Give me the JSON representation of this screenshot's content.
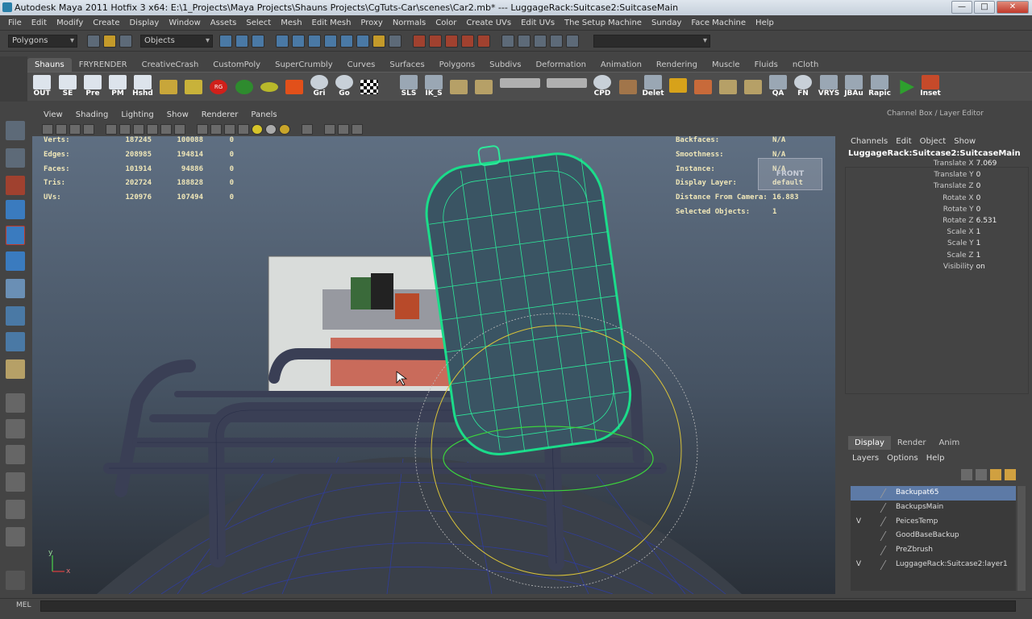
{
  "window": {
    "title": "Autodesk Maya 2011 Hotfix 3 x64: E:\\1_Projects\\Maya Projects\\Shauns Projects\\CgTuts-Car\\scenes\\Car2.mb*  ---  LuggageRack:Suitcase2:SuitcaseMain",
    "minimize": "—",
    "maximize": "□",
    "close": "✕"
  },
  "menubar": [
    "File",
    "Edit",
    "Modify",
    "Create",
    "Display",
    "Window",
    "Assets",
    "Select",
    "Mesh",
    "Edit Mesh",
    "Proxy",
    "Normals",
    "Color",
    "Create UVs",
    "Edit UVs",
    "The Setup Machine",
    "Sunday",
    "Face Machine",
    "Help"
  ],
  "statusline": {
    "mode": "Polygons",
    "selection_mask": "Objects"
  },
  "shelf_tabs": [
    "Shauns",
    "FRYRENDER",
    "CreativeCrash",
    "CustomPoly",
    "SuperCrumbly",
    "Curves",
    "Surfaces",
    "Polygons",
    "Subdivs",
    "Deformation",
    "Animation",
    "Rendering",
    "Muscle",
    "Fluids",
    "nCloth"
  ],
  "shelf_labels": {
    "out": "OUT",
    "se": "SE",
    "pre": "Pre",
    "pm": "PM",
    "hshd": "Hshd",
    "gri": "Gri",
    "go": "Go",
    "sls": "SLS",
    "ik_s": "IK_S",
    "cpd": "CPD",
    "delet": "Delet",
    "qa": "QA",
    "fn": "FN",
    "vrys": "VRYS",
    "jbau": "JBAu",
    "rapic": "Rapic",
    "inset": "Inset",
    "rg": "RG"
  },
  "viewport_menu": [
    "View",
    "Shading",
    "Lighting",
    "Show",
    "Renderer",
    "Panels"
  ],
  "hud_left": [
    {
      "label": "Verts:",
      "a": "187245",
      "b": "100088",
      "c": "0"
    },
    {
      "label": "Edges:",
      "a": "208985",
      "b": "194814",
      "c": "0"
    },
    {
      "label": "Faces:",
      "a": "101914",
      "b": "94886",
      "c": "0"
    },
    {
      "label": "Tris:",
      "a": "202724",
      "b": "188828",
      "c": "0"
    },
    {
      "label": "UVs:",
      "a": "120976",
      "b": "107494",
      "c": "0"
    }
  ],
  "hud_right": [
    {
      "label": "Backfaces:",
      "value": "N/A"
    },
    {
      "label": "Smoothness:",
      "value": "N/A"
    },
    {
      "label": "Instance:",
      "value": "N/A"
    },
    {
      "label": "Display Layer:",
      "value": "default"
    },
    {
      "label": "Distance From Camera:",
      "value": "16.883"
    },
    {
      "label": "Selected Objects:",
      "value": "1"
    }
  ],
  "view_cube_label": "FRONT",
  "channel_box": {
    "title": "Channel Box / Layer Editor",
    "menu": [
      "Channels",
      "Edit",
      "Object",
      "Show"
    ],
    "object": "LuggageRack:Suitcase2:SuitcaseMain",
    "channels": [
      {
        "name": "Translate X",
        "value": "7.069"
      },
      {
        "name": "Translate Y",
        "value": "0"
      },
      {
        "name": "Translate Z",
        "value": "0"
      },
      {
        "name": "Rotate X",
        "value": "0"
      },
      {
        "name": "Rotate Y",
        "value": "0"
      },
      {
        "name": "Rotate Z",
        "value": "6.531"
      },
      {
        "name": "Scale X",
        "value": "1"
      },
      {
        "name": "Scale Y",
        "value": "1"
      },
      {
        "name": "Scale Z",
        "value": "1"
      },
      {
        "name": "Visibility",
        "value": "on"
      }
    ]
  },
  "layer_editor": {
    "tabs": [
      "Display",
      "Render",
      "Anim"
    ],
    "menu": [
      "Layers",
      "Options",
      "Help"
    ],
    "layers": [
      {
        "v": "",
        "name": "Backupat65",
        "selected": true
      },
      {
        "v": "",
        "name": "BackupsMain",
        "selected": false
      },
      {
        "v": "V",
        "name": "PeicesTemp",
        "selected": false
      },
      {
        "v": "",
        "name": "GoodBaseBackup",
        "selected": false
      },
      {
        "v": "",
        "name": "PreZbrush",
        "selected": false
      },
      {
        "v": "V",
        "name": "LuggageRack:Suitcase2:layer1",
        "selected": false
      }
    ]
  },
  "command_line": {
    "label": "MEL"
  },
  "axis": {
    "x": "x",
    "y": "y"
  }
}
